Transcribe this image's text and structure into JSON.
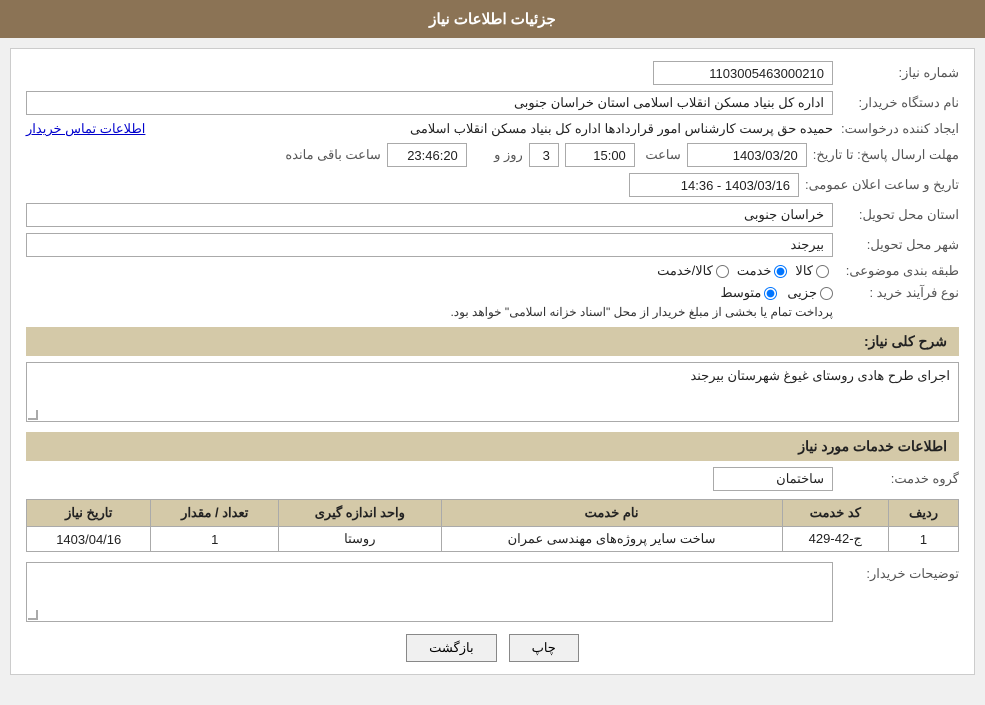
{
  "header": {
    "title": "جزئیات اطلاعات نیاز"
  },
  "fields": {
    "shomara_niaz_label": "شماره نیاز:",
    "shomara_niaz_value": "1103005463000210",
    "nam_dastgah_label": "نام دستگاه خریدار:",
    "nam_dastgah_value": "اداره کل بنیاد مسکن انقلاب اسلامی استان خراسان جنوبی",
    "ejad_konande_label": "ایجاد کننده درخواست:",
    "ejad_konande_value": "حمیده حق پرست کارشناس امور قراردادها اداره کل بنیاد مسکن انقلاب اسلامی",
    "ejad_konande_link": "اطلاعات تماس خریدار",
    "mohlat_label": "مهلت ارسال پاسخ: تا تاریخ:",
    "tarikh_value": "1403/03/20",
    "saat_label": "ساعت",
    "saat_value": "15:00",
    "rooz_label": "روز و",
    "rooz_value": "3",
    "baqi_label": "ساعت باقی مانده",
    "baqi_value": "23:46:20",
    "tarikh_elan_label": "تاریخ و ساعت اعلان عمومی:",
    "tarikh_elan_value": "1403/03/16 - 14:36",
    "ostan_tahvil_label": "استان محل تحویل:",
    "ostan_tahvil_value": "خراسان جنوبی",
    "shahr_tahvil_label": "شهر محل تحویل:",
    "shahr_tahvil_value": "بیرجند",
    "tabaqe_label": "طبقه بندی موضوعی:",
    "tabaqe_options": [
      "کالا",
      "خدمت",
      "کالا/خدمت"
    ],
    "tabaqe_selected": "خدمت",
    "nofarayand_label": "نوع فرآیند خرید :",
    "nofarayand_options": [
      "جزیی",
      "متوسط"
    ],
    "nofarayand_selected": "متوسط",
    "nofarayand_note": "پرداخت تمام یا بخشی از مبلغ خریدار از محل \"اسناد خزانه اسلامی\" خواهد بود.",
    "sharh_niaz_label": "شرح کلی نیاز:",
    "sharh_niaz_value": "اجرای طرح هادی روستای غیوغ شهرستان بیرجند",
    "khadamat_title": "اطلاعات خدمات مورد نیاز",
    "grohe_label": "گروه خدمت:",
    "grohe_value": "ساختمان",
    "table": {
      "headers": [
        "ردیف",
        "کد خدمت",
        "نام خدمت",
        "واحد اندازه گیری",
        "تعداد / مقدار",
        "تاریخ نیاز"
      ],
      "rows": [
        {
          "radif": "1",
          "kod": "ج-42-429",
          "name": "ساخت سایر پروژه‌های مهندسی عمران",
          "vahed": "روستا",
          "tedad": "1",
          "tarikh": "1403/04/16"
        }
      ]
    },
    "tawzihat_label": "توضیحات خریدار:",
    "tawzihat_value": ""
  },
  "buttons": {
    "chap_label": "چاپ",
    "bazgasht_label": "بازگشت"
  }
}
